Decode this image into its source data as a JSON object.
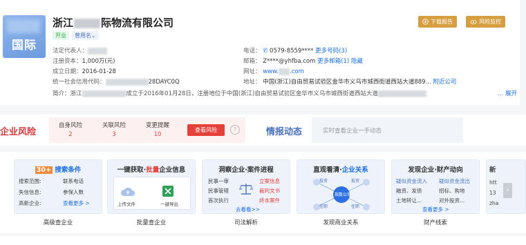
{
  "company": {
    "logo_text": "国际",
    "name_prefix": "浙江",
    "name_suffix": "际物流有限公司",
    "status_tag": "开业",
    "former_name_tag": "曾用名⌄",
    "legal_rep_label": "法定代表人：",
    "capital_label": "注册资本：",
    "capital_value": "1,000万(元)",
    "founded_label": "成立日期：",
    "founded_value": "2016-01-28",
    "credit_code_label": "统一社会信用代码：",
    "credit_code_value": "28DAYC0Q",
    "phone_label": "电话：",
    "phone_value": "0579-8559****",
    "phone_more": "更多号码(3)",
    "email_label": "邮箱：",
    "email_value": "Z****@yhfba.com",
    "email_more": "更多邮箱(1)",
    "email_hide": "隐藏",
    "website_label": "网址：",
    "website_prefix": "www.",
    "website_suffix": ".com",
    "address_label": "地址：",
    "address_value": "中国(浙江)自由贸易试验区金华市义乌市城西街道西站大道889...",
    "nearby": "附近公司",
    "intro_label": "简介：",
    "intro_prefix": "浙江",
    "intro_text": "成立于2016年01月28日，注册地位于中国(浙江)自由贸易试验区金华市义乌市城西街道西站大道",
    "expand": "... 展开"
  },
  "actions": {
    "download": "下载报告",
    "monitor": "风险监控"
  },
  "risk": {
    "title": "企业风险",
    "items": [
      {
        "label": "自身风险",
        "count": "2"
      },
      {
        "label": "关联风险",
        "count": "3"
      },
      {
        "label": "变更提醒",
        "count": "10"
      }
    ],
    "button": "查看风险",
    "help": "?"
  },
  "intel": {
    "title": "情报动态",
    "placeholder": "实时查看企业一手动态"
  },
  "promos": [
    {
      "caption": "高级查企业",
      "badge": "30+",
      "title": "搜索条件",
      "items": [
        "搜索范围:",
        "联系电话",
        "失信信息:",
        "参保人数",
        "高新企业:"
      ],
      "more": "查看更多 >"
    },
    {
      "caption": "批量查企业",
      "title_a": "一键获取·",
      "title_b": "批量",
      "title_c": "企业信息",
      "upload": "上传文件",
      "export": "一键导出"
    },
    {
      "caption": "司法解析",
      "title": "洞察企业·案件进程",
      "left": [
        "民事一审",
        "民事管辖",
        "首次执行"
      ],
      "right": [
        "立案信息",
        "裁判文书",
        "终本案件"
      ],
      "more": "去看看>>"
    },
    {
      "caption": "发现商业关系",
      "title_a": "直观看清·",
      "title_b": "企业关系",
      "center": "指数公司",
      "nodes": [
        "投资",
        "投资",
        "任职",
        "任职"
      ]
    },
    {
      "caption": "财产线索",
      "title": "发现企业·财产动向",
      "items": [
        "疑似资金流入",
        "疑似资金流出",
        "融资、发债",
        "招标、购地",
        "土地转让...",
        "对外投资..."
      ],
      "more": "查看更多 >"
    }
  ],
  "partial_card": {
    "title": "新",
    "rows": [
      "htt",
      "13",
      "zha"
    ]
  },
  "colors": {
    "accent_gold": "#d69e3f",
    "risk_red": "#d8383b",
    "link_blue": "#1b6fe4"
  }
}
